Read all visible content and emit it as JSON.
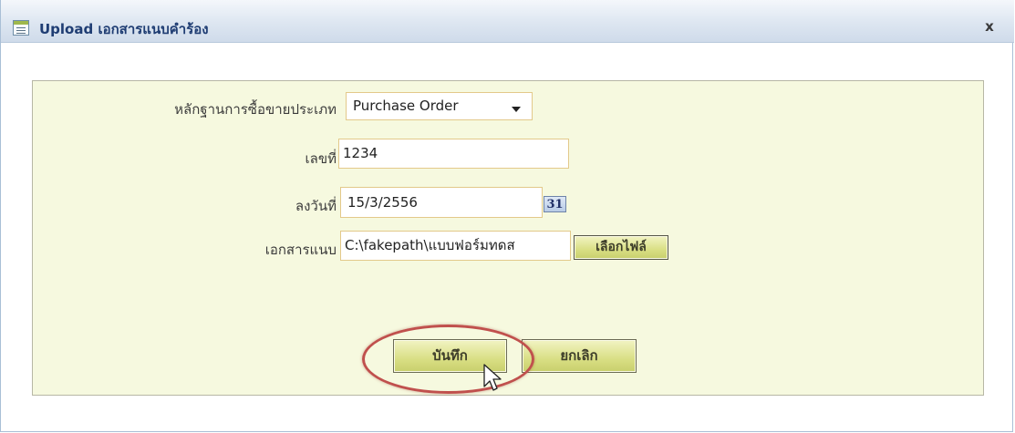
{
  "dialog": {
    "title": "Upload เอกสารแนบคำร้อง",
    "close_label": "x"
  },
  "form": {
    "doc_type": {
      "label": "หลักฐานการซื้อขายประเภท",
      "value": "Purchase Order"
    },
    "doc_number": {
      "label": "เลขที่",
      "value": "1234"
    },
    "doc_date": {
      "label": "ลงวันที่",
      "value": "15/3/2556",
      "calendar_icon_text": "31"
    },
    "attachment": {
      "label": "เอกสารแนบ",
      "value": "C:\\fakepath\\แบบฟอร์มทดส",
      "browse_label": "เลือกไฟล์"
    }
  },
  "actions": {
    "save_label": "บันทึก",
    "cancel_label": "ยกเลิก"
  },
  "colors": {
    "panel_bg": "#f6f9df",
    "button_bg": "#d9df84",
    "highlight": "#c0504d",
    "title_text": "#1f3d73"
  }
}
